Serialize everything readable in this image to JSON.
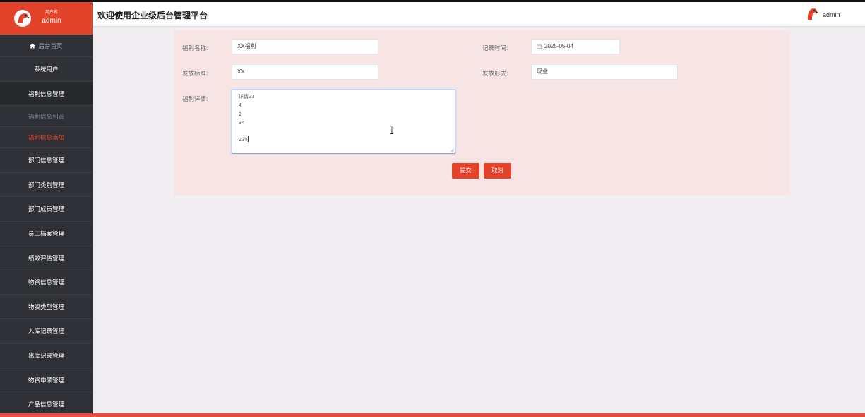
{
  "sidebar": {
    "user_role": "用户名",
    "user_name": "admin",
    "items": [
      {
        "label": "后台首页"
      },
      {
        "label": "系统用户"
      },
      {
        "label": "福利信息管理"
      },
      {
        "label": "福利信息列表"
      },
      {
        "label": "福利信息添加"
      },
      {
        "label": "部门信息管理"
      },
      {
        "label": "部门类别管理"
      },
      {
        "label": "部门成员管理"
      },
      {
        "label": "员工档案管理"
      },
      {
        "label": "绩效评估管理"
      },
      {
        "label": "物资信息管理"
      },
      {
        "label": "物资类型管理"
      },
      {
        "label": "入库记录管理"
      },
      {
        "label": "出库记录管理"
      },
      {
        "label": "物资申领管理"
      },
      {
        "label": "产品信息管理"
      }
    ]
  },
  "header": {
    "title": "欢迎使用企业级后台管理平台",
    "user_name": "admin"
  },
  "form": {
    "name_label": "福利名称:",
    "name_value": "XX福利",
    "time_label": "记录时间:",
    "time_value": "2025-05-04",
    "standard_label": "发放标准:",
    "standard_value": "XX",
    "method_label": "发放形式:",
    "method_value": "现金",
    "detail_label": "福利详情:",
    "detail_lines": [
      "详情23",
      "4",
      "2",
      "34",
      "",
      "234"
    ],
    "submit_label": "提交",
    "cancel_label": "取消"
  },
  "colors": {
    "accent": "#e4432b",
    "sidebar_bg": "#2f3136",
    "panel_bg": "#f7e5e5",
    "main_bg": "#f0eef0"
  },
  "icons": {
    "home": "home-icon",
    "calendar": "calendar-icon",
    "avatar": "parrot-avatar-icon",
    "cursor": "text-cursor-icon"
  }
}
